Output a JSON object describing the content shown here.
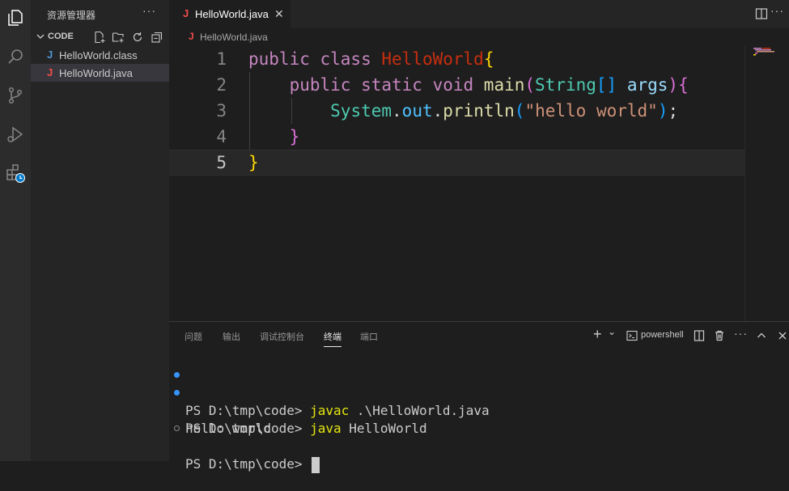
{
  "sidebar": {
    "title": "资源管理器",
    "more": "···",
    "folder": "CODE",
    "files": [
      {
        "icon": "J",
        "label": "HelloWorld.class",
        "icon_color": "#4e94ce"
      },
      {
        "icon": "J",
        "label": "HelloWorld.java",
        "icon_color": "#f14c4c"
      }
    ]
  },
  "editor": {
    "tab": {
      "icon": "J",
      "label": "HelloWorld.java",
      "close": "✕"
    },
    "more": "···",
    "breadcrumb": {
      "icon": "J",
      "label": "HelloWorld.java"
    },
    "line_numbers": [
      "1",
      "2",
      "3",
      "4",
      "5"
    ],
    "code": {
      "l1": {
        "kw": "public class ",
        "cls": "HelloWorld",
        "br": "{"
      },
      "l2": {
        "indent": "    ",
        "kw": "public static void ",
        "fn": "main",
        "p1": "(",
        "ty": "String",
        "arr": "[]",
        "sp": " ",
        "par": "args",
        "p2": ")",
        "br": "{"
      },
      "l3": {
        "indent": "        ",
        "sys": "System",
        "d1": ".",
        "out": "out",
        "d2": ".",
        "fn": "println",
        "p1": "(",
        "str": "\"hello world\"",
        "p2": ")",
        "semi": ";"
      },
      "l4": {
        "indent": "    ",
        "br": "}"
      },
      "l5": {
        "br": "}"
      }
    }
  },
  "panel": {
    "tabs": [
      "问题",
      "输出",
      "调试控制台",
      "终端",
      "端口"
    ],
    "active_tab": "终端",
    "add": "+",
    "dropdown": "⌄",
    "shell": "powershell",
    "more": "···",
    "terminal": [
      {
        "prompt": "PS D:\\tmp\\code> ",
        "cmd": "javac",
        "rest": " .\\HelloWorld.java",
        "dot": "filled"
      },
      {
        "prompt": "PS D:\\tmp\\code> ",
        "cmd": "java",
        "rest": " HelloWorld",
        "dot": "filled"
      },
      {
        "output": "hello world"
      },
      {
        "prompt": "PS D:\\tmp\\code> ",
        "dot": "hollow"
      }
    ]
  },
  "colors": {
    "accent": "#007acc",
    "java_icon": "#f14c4c",
    "class_icon": "#4e94ce",
    "terminal_cmd": "#e5e510"
  }
}
